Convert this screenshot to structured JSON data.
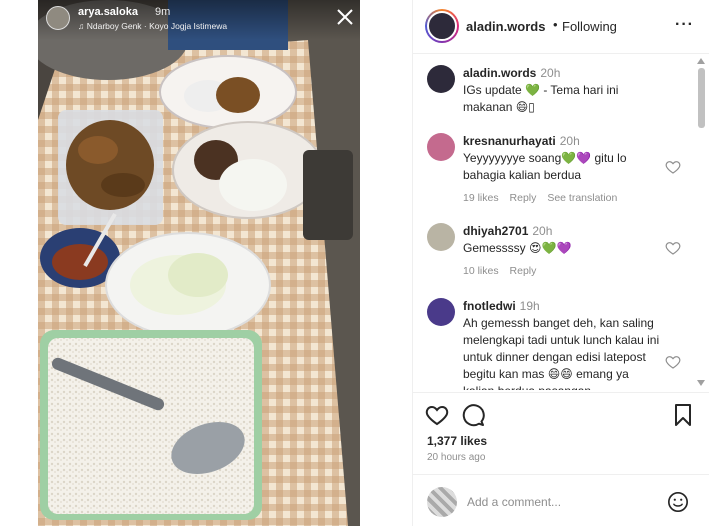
{
  "story": {
    "username": "arya.saloka",
    "time": "9m",
    "music": "Ndarboy Genk · Koyo Jogja Istimewa"
  },
  "post": {
    "username": "aladin.words",
    "separator": "•",
    "follow_status": "Following"
  },
  "comments": [
    {
      "username": "aladin.words",
      "time": "20h",
      "text": "IGs update 💚 - Tema hari ini makanan 😄▯"
    },
    {
      "username": "kresnanurhayati",
      "time": "20h",
      "text": "Yeyyyyyyye soang💚💜 gitu lo bahagia kalian berdua",
      "likes": "19 likes",
      "reply": "Reply",
      "translate": "See translation"
    },
    {
      "username": "dhiyah2701",
      "time": "20h",
      "text": "Gemessssy 😍💚💜",
      "likes": "10 likes",
      "reply": "Reply"
    },
    {
      "username": "fnotledwi",
      "time": "19h",
      "text": "Ah gemessh banget deh, kan saling melengkapi tadi untuk lunch kalau ini untuk dinner dengan edisi latepost begitu kan mas 😄😄 emang ya kalian berdua pasangan"
    }
  ],
  "actions": {
    "likes": "1,377 likes",
    "ago": "20 hours ago"
  },
  "add_comment": {
    "placeholder": "Add a comment..."
  },
  "icons": {
    "story_close": "close-icon",
    "more": "more-options-icon",
    "like": "heart-icon",
    "comment": "comment-icon",
    "save": "bookmark-icon",
    "emoji": "emoji-icon"
  }
}
